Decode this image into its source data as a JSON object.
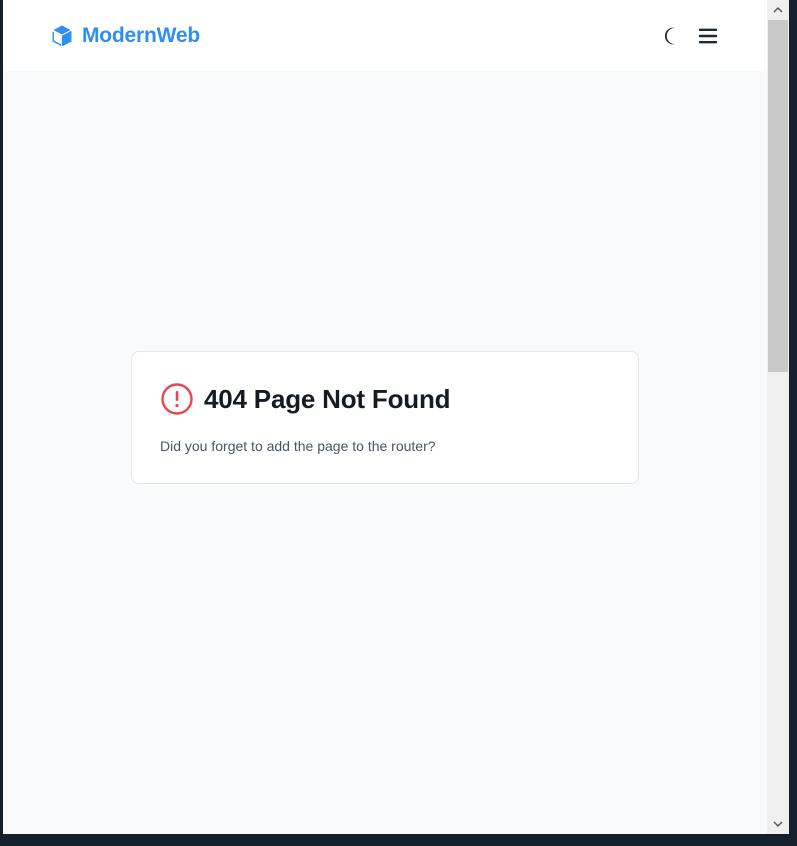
{
  "header": {
    "brand_name": "ModernWeb",
    "brand_icon": "cube-icon",
    "theme_toggle_icon": "moon-icon",
    "menu_icon": "hamburger-menu-icon"
  },
  "card": {
    "title": "404 Page Not Found",
    "message": "Did you forget to add the page to the router?",
    "icon": "alert-circle-icon"
  },
  "colors": {
    "brand": "#2e8ff0",
    "error": "#e5484d",
    "page_bg": "#f8fafb",
    "card_bg": "#ffffff",
    "frame": "#14202b"
  }
}
